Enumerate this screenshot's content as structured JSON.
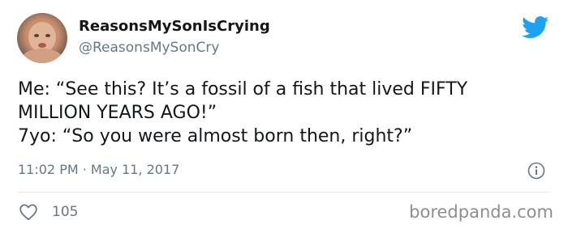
{
  "author": {
    "display_name": "ReasonsMySonIsCrying",
    "handle": "@ReasonsMySonCry"
  },
  "tweet": {
    "lines": [
      "Me: “See this? It’s a fossil of a fish that lived FIFTY",
      "MILLION YEARS AGO!”",
      "7yo: “So you were almost born then, right?”"
    ],
    "timestamp": "11:02 PM · May 11, 2017",
    "like_count": "105"
  },
  "watermark": "boredpanda.com",
  "colors": {
    "twitter_blue": "#1da1f2",
    "secondary_text": "#657786",
    "primary_text": "#14171a"
  },
  "icons": {
    "brand": "twitter-bird-icon",
    "info": "info-icon",
    "like": "heart-icon"
  }
}
